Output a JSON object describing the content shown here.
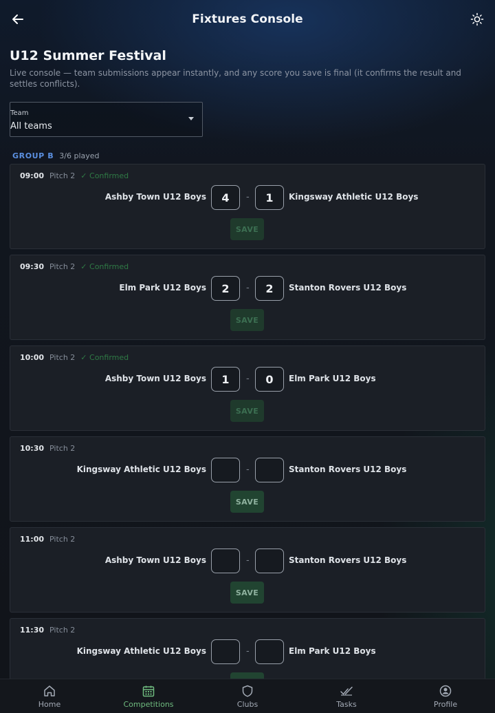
{
  "appbar": {
    "title": "Fixtures Console"
  },
  "competition": {
    "title": "U12 Summer Festival",
    "subtitle": "Live console — team submissions appear instantly, and any score you save is final (it confirms the result and settles conflicts)."
  },
  "team_filter": {
    "label": "Team",
    "value": "All teams"
  },
  "group": {
    "name": "GROUP B",
    "played": "3/6 played"
  },
  "fixtures": [
    {
      "time": "09:00",
      "pitch": "Pitch 2",
      "status": "✓ Confirmed",
      "home": "Ashby Town U12 Boys",
      "away": "Kingsway Athletic U12 Boys",
      "home_score": "4",
      "away_score": "1",
      "dash": "-",
      "save": "SAVE"
    },
    {
      "time": "09:30",
      "pitch": "Pitch 2",
      "status": "✓ Confirmed",
      "home": "Elm Park U12 Boys",
      "away": "Stanton Rovers U12 Boys",
      "home_score": "2",
      "away_score": "2",
      "dash": "-",
      "save": "SAVE"
    },
    {
      "time": "10:00",
      "pitch": "Pitch 2",
      "status": "✓ Confirmed",
      "home": "Ashby Town U12 Boys",
      "away": "Elm Park U12 Boys",
      "home_score": "1",
      "away_score": "0",
      "dash": "-",
      "save": "SAVE"
    },
    {
      "time": "10:30",
      "pitch": "Pitch 2",
      "status": "",
      "home": "Kingsway Athletic U12 Boys",
      "away": "Stanton Rovers U12 Boys",
      "home_score": "",
      "away_score": "",
      "dash": "-",
      "save": "SAVE"
    },
    {
      "time": "11:00",
      "pitch": "Pitch 2",
      "status": "",
      "home": "Ashby Town U12 Boys",
      "away": "Stanton Rovers U12 Boys",
      "home_score": "",
      "away_score": "",
      "dash": "-",
      "save": "SAVE"
    },
    {
      "time": "11:30",
      "pitch": "Pitch 2",
      "status": "",
      "home": "Kingsway Athletic U12 Boys",
      "away": "Elm Park U12 Boys",
      "home_score": "",
      "away_score": "",
      "dash": "-",
      "save": "SAVE"
    }
  ],
  "nav": [
    {
      "label": "Home",
      "icon": "home-icon"
    },
    {
      "label": "Competitions",
      "icon": "calendar-icon",
      "selected": true
    },
    {
      "label": "Clubs",
      "icon": "shield-icon"
    },
    {
      "label": "Tasks",
      "icon": "double-check-icon"
    },
    {
      "label": "Profile",
      "icon": "profile-icon"
    }
  ],
  "colors": {
    "accent": "#6fbb7f",
    "group": "#5b8fe0",
    "confirmed": "#2f7a45"
  }
}
